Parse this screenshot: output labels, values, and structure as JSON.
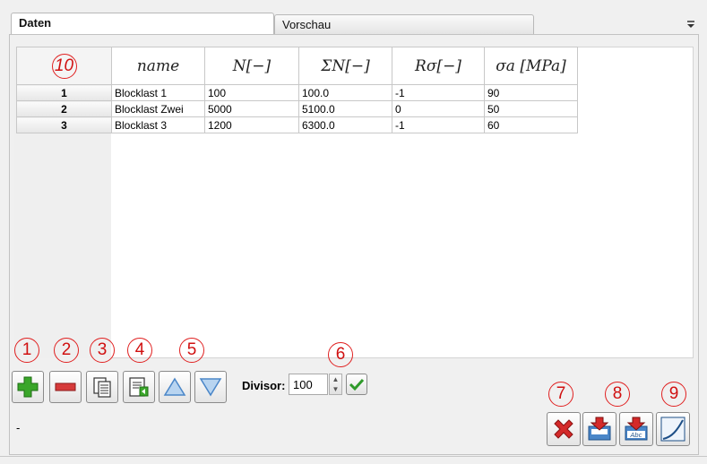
{
  "tabs": [
    {
      "label": "Daten",
      "active": true
    },
    {
      "label": "Vorschau",
      "active": false
    }
  ],
  "table": {
    "corner_label": "10",
    "columns": [
      "name",
      "N[−]",
      "ΣN[−]",
      "Rσ[−]",
      "σa [MPa]"
    ],
    "rows": [
      {
        "index": "1",
        "name": "Blocklast 1",
        "n": "100",
        "sum_n": "100.0",
        "r_sigma": "-1",
        "sigma_a": "90"
      },
      {
        "index": "2",
        "name": "Blocklast Zwei",
        "n": "5000",
        "sum_n": "5100.0",
        "r_sigma": "0",
        "sigma_a": "50"
      },
      {
        "index": "3",
        "name": "Blocklast 3",
        "n": "1200",
        "sum_n": "6300.0",
        "r_sigma": "-1",
        "sigma_a": "60"
      }
    ]
  },
  "toolbar": {
    "callouts": [
      "1",
      "2",
      "3",
      "4",
      "5",
      "6",
      "7",
      "8",
      "9"
    ],
    "icons": [
      "add-row-icon",
      "remove-row-icon",
      "copy-icon",
      "paste-icon",
      "move-up-icon",
      "move-down-icon",
      "apply-icon",
      "delete-icon",
      "import-icon",
      "import-text-icon",
      "curve-icon"
    ],
    "divisor_label": "Divisor:",
    "divisor_value": "100"
  },
  "status_text": "-",
  "colors": {
    "callout": "#e02020",
    "add_green": "#3aa62a",
    "remove_red": "#d63a3a",
    "move_blue": "#4a86c8",
    "delete_red": "#d42a2a"
  }
}
